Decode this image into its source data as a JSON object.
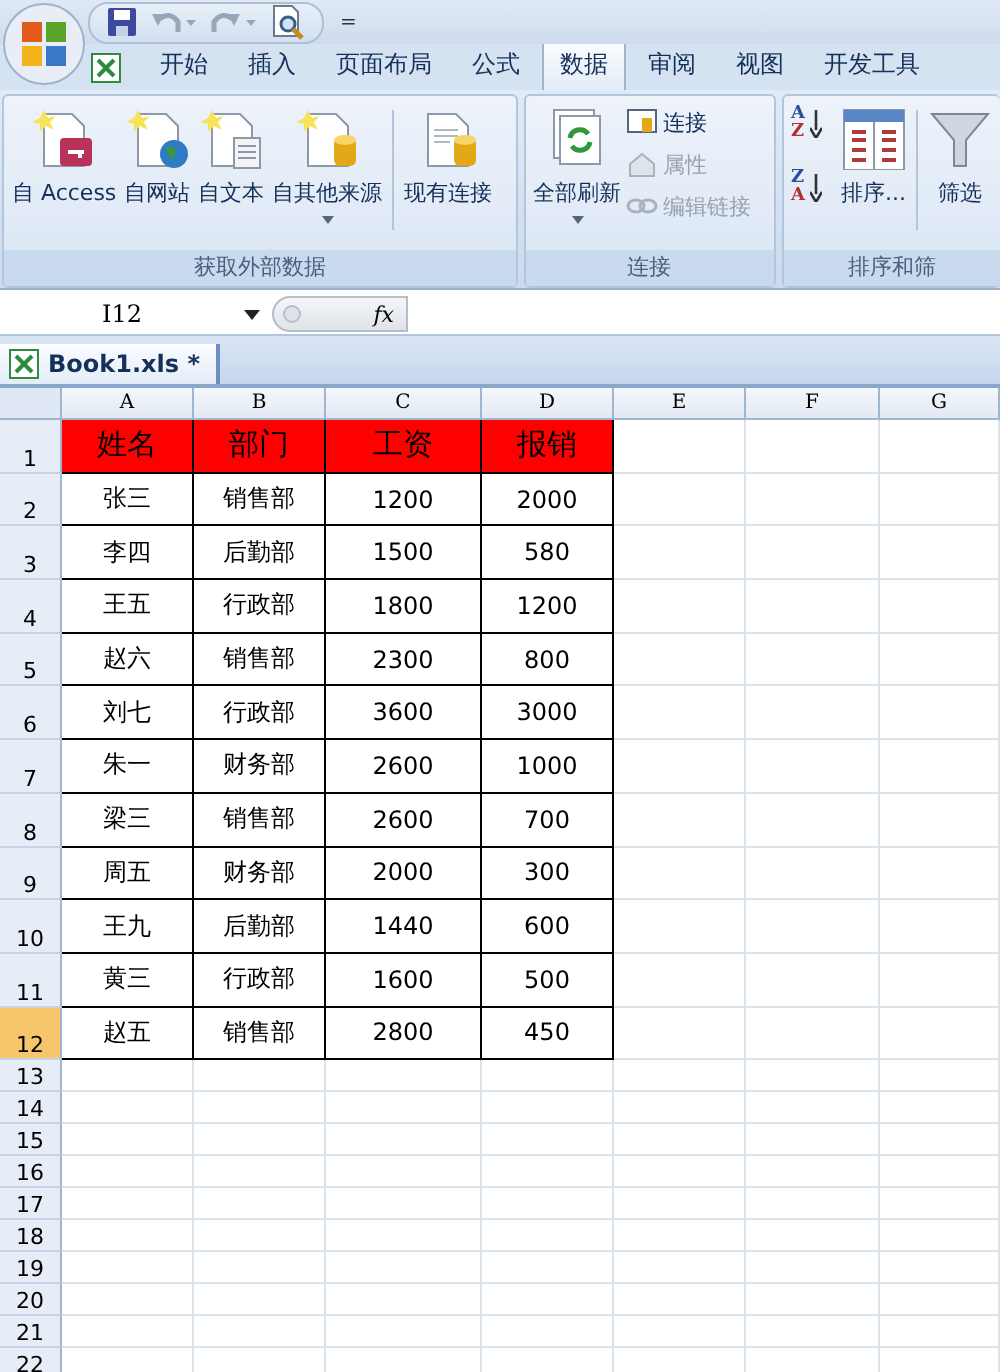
{
  "quick_access": {
    "customize": "="
  },
  "tabs": [
    {
      "label": "开始",
      "selected": false
    },
    {
      "label": "插入",
      "selected": false
    },
    {
      "label": "页面布局",
      "selected": false
    },
    {
      "label": "公式",
      "selected": false
    },
    {
      "label": "数据",
      "selected": true
    },
    {
      "label": "审阅",
      "selected": false
    },
    {
      "label": "视图",
      "selected": false
    },
    {
      "label": "开发工具",
      "selected": false
    }
  ],
  "ribbon_groups": [
    {
      "label": "获取外部数据",
      "buttons": [
        {
          "kind": "large",
          "label": "自 Access",
          "disabled": false
        },
        {
          "kind": "large",
          "label": "自网站",
          "disabled": false
        },
        {
          "kind": "large",
          "label": "自文本",
          "disabled": false
        },
        {
          "kind": "large",
          "label": "自其他来源",
          "disabled": false,
          "dropdown": true
        },
        {
          "kind": "large",
          "label": "现有连接",
          "disabled": false,
          "separator_before": true
        }
      ]
    },
    {
      "label": "连接",
      "buttons": [
        {
          "kind": "large",
          "label": "全部刷新",
          "disabled": false,
          "dropdown": true
        },
        {
          "kind": "small",
          "label": "连接",
          "disabled": false
        },
        {
          "kind": "small",
          "label": "属性",
          "disabled": true
        },
        {
          "kind": "small",
          "label": "编辑链接",
          "disabled": true
        }
      ]
    },
    {
      "label": "排序和筛",
      "buttons": [
        {
          "kind": "sort",
          "letters": [
            "A",
            "Z"
          ],
          "disabled": false
        },
        {
          "kind": "sort",
          "letters": [
            "Z",
            "A"
          ],
          "disabled": false
        },
        {
          "kind": "large",
          "label": "排序...",
          "disabled": false
        },
        {
          "kind": "large",
          "label": "筛选",
          "disabled": false,
          "separator_before": true
        }
      ]
    }
  ],
  "formula_bar": {
    "name_box": "I12",
    "function_label": "fx"
  },
  "document_tab": {
    "title": "Book1.xls *"
  },
  "sheet": {
    "columns": [
      {
        "label": "A"
      },
      {
        "label": "B"
      },
      {
        "label": "C"
      },
      {
        "label": "D"
      },
      {
        "label": "E"
      },
      {
        "label": "F"
      },
      {
        "label": "G"
      }
    ],
    "rows": [
      {
        "number": "1",
        "selected": false,
        "header": true,
        "cells": [
          "姓名",
          "部门",
          "工资",
          "报销"
        ]
      },
      {
        "number": "2",
        "selected": false,
        "header": false,
        "cells": [
          "张三",
          "销售部",
          "1200",
          "2000"
        ]
      },
      {
        "number": "3",
        "selected": false,
        "header": false,
        "cells": [
          "李四",
          "后勤部",
          "1500",
          "580"
        ]
      },
      {
        "number": "4",
        "selected": false,
        "header": false,
        "cells": [
          "王五",
          "行政部",
          "1800",
          "1200"
        ]
      },
      {
        "number": "5",
        "selected": false,
        "header": false,
        "cells": [
          "赵六",
          "销售部",
          "2300",
          "800"
        ]
      },
      {
        "number": "6",
        "selected": false,
        "header": false,
        "cells": [
          "刘七",
          "行政部",
          "3600",
          "3000"
        ]
      },
      {
        "number": "7",
        "selected": false,
        "header": false,
        "cells": [
          "朱一",
          "财务部",
          "2600",
          "1000"
        ]
      },
      {
        "number": "8",
        "selected": false,
        "header": false,
        "cells": [
          "梁三",
          "销售部",
          "2600",
          "700"
        ]
      },
      {
        "number": "9",
        "selected": false,
        "header": false,
        "cells": [
          "周五",
          "财务部",
          "2000",
          "300"
        ]
      },
      {
        "number": "10",
        "selected": false,
        "header": false,
        "cells": [
          "王九",
          "后勤部",
          "1440",
          "600"
        ]
      },
      {
        "number": "11",
        "selected": false,
        "header": false,
        "cells": [
          "黄三",
          "行政部",
          "1600",
          "500"
        ]
      },
      {
        "number": "12",
        "selected": true,
        "header": false,
        "cells": [
          "赵五",
          "销售部",
          "2800",
          "450"
        ]
      },
      {
        "number": "13",
        "selected": false
      },
      {
        "number": "14",
        "selected": false
      },
      {
        "number": "15",
        "selected": false
      },
      {
        "number": "16",
        "selected": false
      },
      {
        "number": "17",
        "selected": false
      },
      {
        "number": "18",
        "selected": false
      },
      {
        "number": "19",
        "selected": false
      },
      {
        "number": "20",
        "selected": false
      },
      {
        "number": "21",
        "selected": false
      },
      {
        "number": "22",
        "selected": false
      }
    ]
  }
}
